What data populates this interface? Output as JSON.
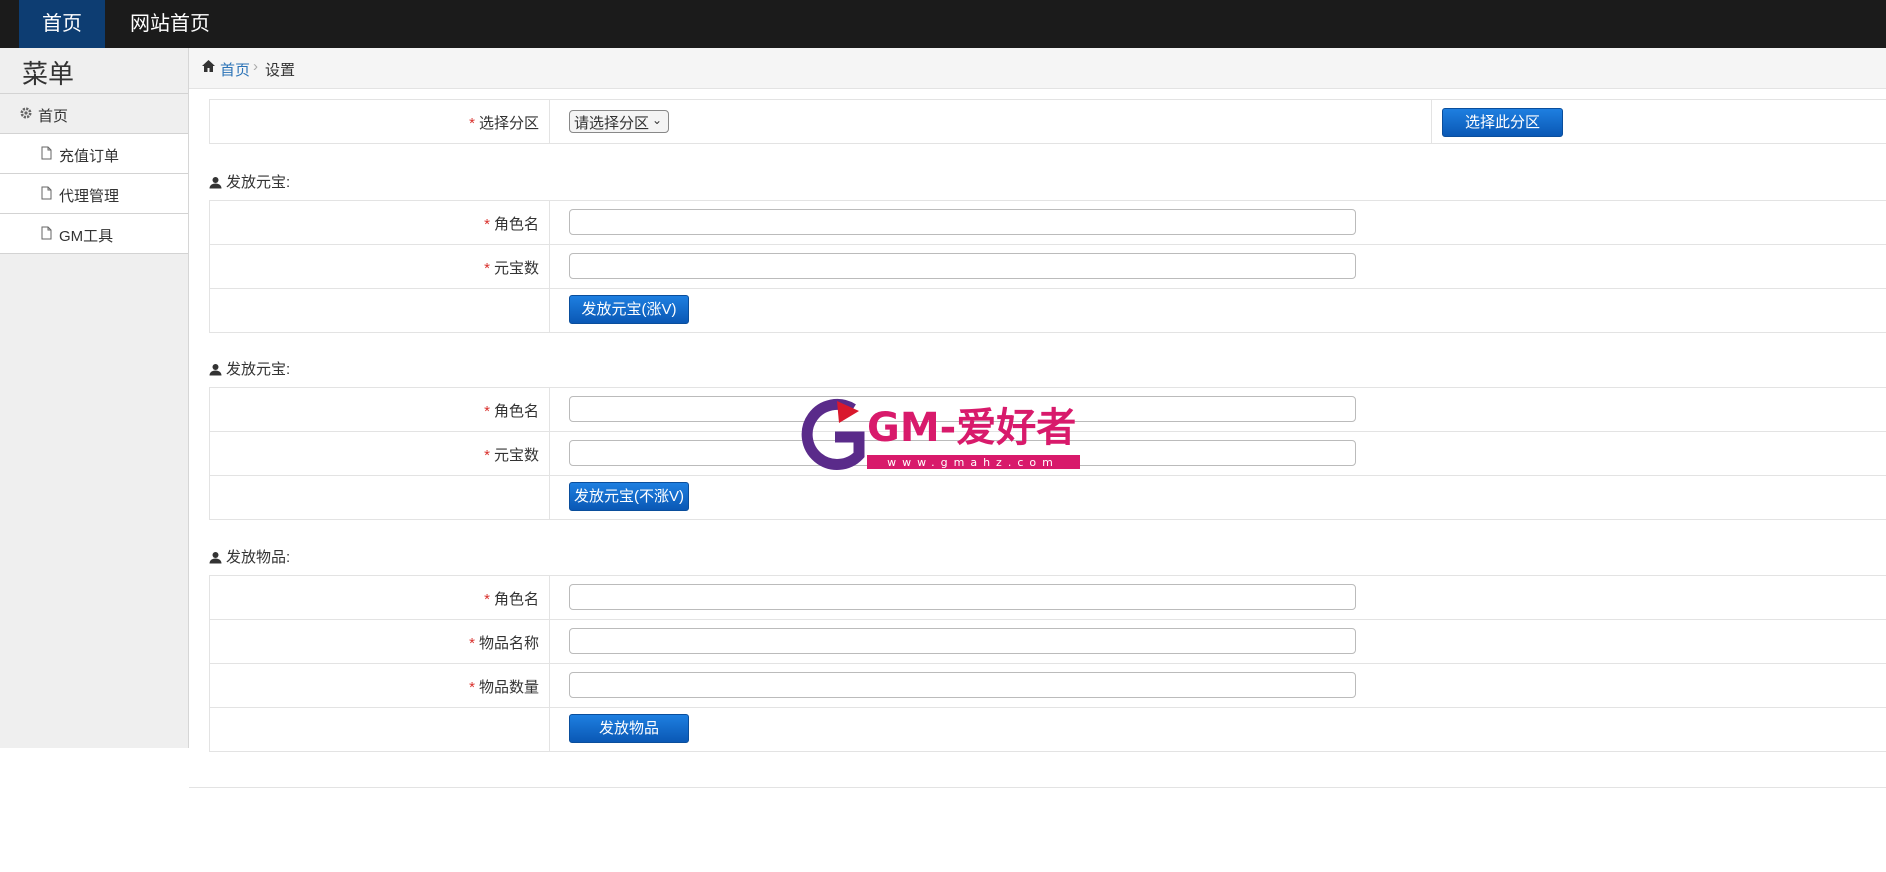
{
  "topbar": {
    "home": "首页",
    "site_home": "网站首页"
  },
  "sidebar": {
    "title": "菜单",
    "home": "首页",
    "items": [
      {
        "label": "充值订单"
      },
      {
        "label": "代理管理"
      },
      {
        "label": "GM工具"
      }
    ]
  },
  "breadcrumb": {
    "home": "首页",
    "separator": "›",
    "current": "设置"
  },
  "zone": {
    "label": "选择分区",
    "select_value": "请选择分区",
    "button": "选择此分区"
  },
  "sections": [
    {
      "title": "发放元宝:",
      "fields": [
        {
          "label": "角色名",
          "value": ""
        },
        {
          "label": "元宝数",
          "value": ""
        }
      ],
      "button": "发放元宝(涨V)"
    },
    {
      "title": "发放元宝:",
      "fields": [
        {
          "label": "角色名",
          "value": ""
        },
        {
          "label": "元宝数",
          "value": ""
        }
      ],
      "button": "发放元宝(不涨V)"
    },
    {
      "title": "发放物品:",
      "fields": [
        {
          "label": "角色名",
          "value": ""
        },
        {
          "label": "物品名称",
          "value": ""
        },
        {
          "label": "物品数量",
          "value": ""
        }
      ],
      "button": "发放物品"
    }
  ],
  "watermark": {
    "brand": "GM-爱好者",
    "url": "www.gmahz.com"
  },
  "colors": {
    "accent": "#0d3d72",
    "button": "#0a58b5",
    "required": "#d9302c",
    "link": "#2b73b7"
  }
}
